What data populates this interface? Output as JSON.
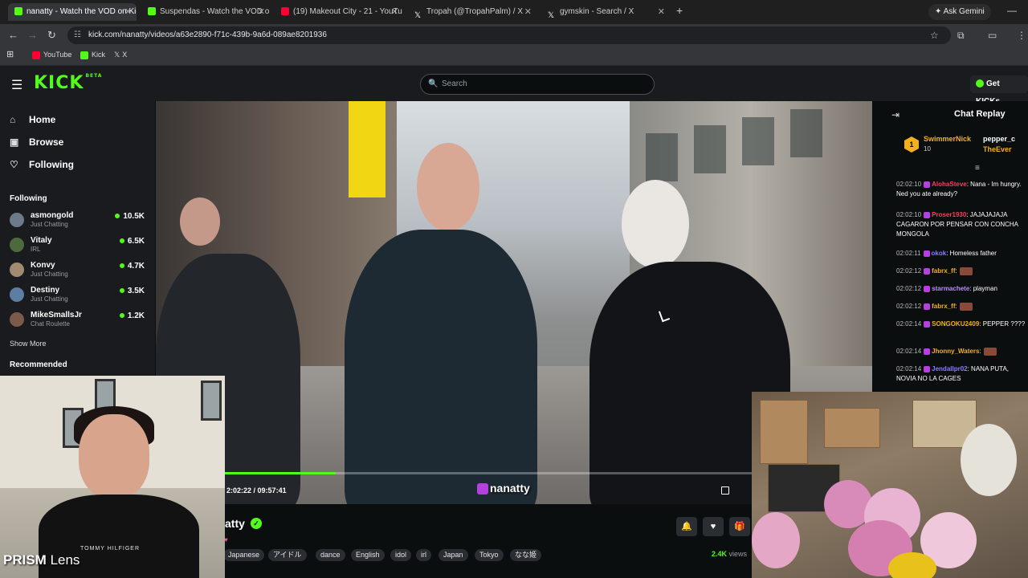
{
  "browser": {
    "tabs": [
      {
        "title": "nanatty - Watch the VOD on Ki",
        "color": "#53fc18",
        "active": true
      },
      {
        "title": "Suspendas - Watch the VOD on",
        "color": "#53fc18",
        "active": false
      },
      {
        "title": "(19) Makeout City - 21 - YouTu",
        "color": "#ff0033",
        "active": false
      },
      {
        "title": "Tropah (@TropahPalm) / X",
        "color": "#ffffff",
        "active": false
      },
      {
        "title": "gymskin - Search / X",
        "color": "#ffffff",
        "active": false
      }
    ],
    "new_tab": "+",
    "gemini_label": "Ask Gemini",
    "url": "kick.com/nanatty/videos/a63e2890-f71c-439b-9a6d-089ae8201936",
    "bookmarks": [
      {
        "label": "YouTube",
        "color": "#ff0033"
      },
      {
        "label": "Kick",
        "color": "#53fc18"
      },
      {
        "label": "X",
        "color": "#ffffff"
      }
    ]
  },
  "header": {
    "logo": "KICK",
    "logo_badge": "BETA",
    "search_placeholder": "Search",
    "get_kicks": "Get KICKs"
  },
  "sidebar": {
    "nav": [
      {
        "label": "Home",
        "icon": "home-icon"
      },
      {
        "label": "Browse",
        "icon": "browse-icon"
      },
      {
        "label": "Following",
        "icon": "heart-icon"
      }
    ],
    "following_title": "Following",
    "following": [
      {
        "name": "asmongold",
        "category": "Just Chatting",
        "viewers": "10.5K",
        "color": "#6c7a8a"
      },
      {
        "name": "Vitaly",
        "category": "IRL",
        "viewers": "6.5K",
        "color": "#4c6a3c"
      },
      {
        "name": "Konvy",
        "category": "Just Chatting",
        "viewers": "4.7K",
        "color": "#a08a70"
      },
      {
        "name": "Destiny",
        "category": "Just Chatting",
        "viewers": "3.5K",
        "color": "#5d7ea3"
      },
      {
        "name": "MikeSmallsJr",
        "category": "Chat Roulette",
        "viewers": "1.2K",
        "color": "#7a5a4a"
      }
    ],
    "show_more": "Show More",
    "recommended_title": "Recommended"
  },
  "video": {
    "current_time": "2:02:22",
    "duration": "09:57:41",
    "progress": 0.21,
    "watermark": "nanatty"
  },
  "channel": {
    "name": "atty",
    "tags": [
      "Japanese",
      "アイドル",
      "dance",
      "English",
      "idol",
      "irl",
      "Japan",
      "Tokyo",
      "なな姫"
    ],
    "views": "2.4K",
    "views_label": "views"
  },
  "chat": {
    "title": "Chat Replay",
    "pinned": {
      "rank": "1",
      "name": "SwimmerNick",
      "count": "10",
      "other1": "pepper_c",
      "other2": "TheEver"
    },
    "messages": [
      {
        "time": "02:02:10",
        "user": "AlohaSteve",
        "color": "#ff3b5c",
        "text": ": Nana - Im hungry. Ned you ate already?"
      },
      {
        "time": "02:02:10",
        "user": "Proser1930",
        "color": "#ff3b5c",
        "text": ": JAJAJAJAJA CAGARON POR PENSAR CON CONCHA MONGOLA"
      },
      {
        "time": "02:02:11",
        "user": "okok",
        "color": "#8a7dff",
        "text": ": Homeless father"
      },
      {
        "time": "02:02:12",
        "user": "fabrx_ff",
        "color": "#f2b01e",
        "text": ":"
      },
      {
        "time": "02:02:12",
        "user": "starmachete",
        "color": "#b98bff",
        "text": ": playman"
      },
      {
        "time": "02:02:12",
        "user": "fabrx_ff",
        "color": "#f2b01e",
        "text": ":"
      },
      {
        "time": "02:02:14",
        "user": "SONGOKU2409",
        "color": "#f2b01e",
        "text": ": PEPPER ????"
      },
      {
        "time": "02:02:14",
        "user": "Jhonny_Waters",
        "color": "#f2b01e",
        "text": ":"
      },
      {
        "time": "02:02:14",
        "user": "Jendallpr02",
        "color": "#8a7dff",
        "text": ": NANA PUTA, NOVIA NO LA CAGES"
      }
    ]
  },
  "overlay": {
    "brand_bold": "PRISM",
    "brand_rest": " Lens",
    "shirt_text": "TOMMY HILFIGER"
  }
}
